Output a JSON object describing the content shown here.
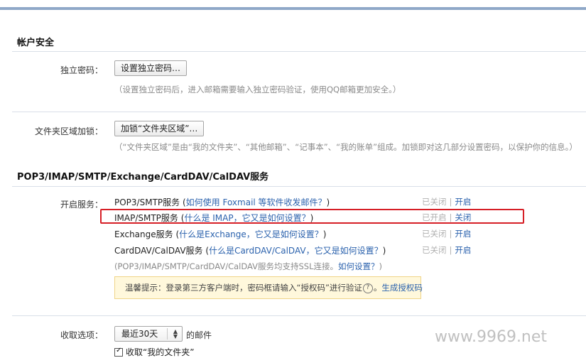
{
  "account_security": {
    "title": "帐户安全",
    "independent_password": {
      "label": "独立密码：",
      "button": "设置独立密码…",
      "hint": "（设置独立密码后，进入邮箱需要输入独立密码验证，使用QQ邮箱更加安全。）"
    },
    "folder_lock": {
      "label": "文件夹区域加锁：",
      "button": "加锁“文件夹区域”…",
      "hint": "（“文件夹区域”是由“我的文件夹”、“其他邮箱”、“记事本”、“我的账单”组成。加锁即对这几部分设置密码，以保护你的信息。）"
    }
  },
  "protocols": {
    "title": "POP3/IMAP/SMTP/Exchange/CardDAV/CalDAV服务",
    "label": "开启服务：",
    "services": [
      {
        "name": "POP3/SMTP服务",
        "help_open": "(",
        "help_link": "如何使用 Foxmail 等软件收发邮件？",
        "help_close": ")",
        "state": "已关闭",
        "separator": "|",
        "action": "开启"
      },
      {
        "name": "IMAP/SMTP服务",
        "help_open": "(",
        "help_link": "什么是 IMAP，它又是如何设置？",
        "help_close": ")",
        "state": "已开启",
        "separator": "|",
        "action": "关闭"
      },
      {
        "name": "Exchange服务",
        "help_open": "(",
        "help_link": "什么是Exchange，它又是如何设置？",
        "help_close": ")",
        "state": "已关闭",
        "separator": "|",
        "action": "开启"
      },
      {
        "name": "CardDAV/CalDAV服务",
        "help_open": "(",
        "help_link": "什么是CardDAV/CalDAV，它又是如何设置？",
        "help_close": ")",
        "state": "已关闭",
        "separator": "|",
        "action": "开启"
      }
    ],
    "ssl_note_prefix": "(POP3/IMAP/SMTP/CardDAV/CalDAV服务均支持SSL连接。",
    "ssl_note_link": "如何设置？",
    "ssl_note_suffix": ")",
    "tip_prefix": "温馨提示：登录第三方客户端时，密码框请输入“授权码”进行验证",
    "tip_qmark": "?",
    "tip_dot": "。",
    "tip_link": "生成授权码"
  },
  "receive": {
    "label": "收取选项：",
    "select_value": "最近30天",
    "after_select": "的邮件",
    "checkbox_label": "收取“我的文件夹”",
    "checkbox_mark": "✓"
  },
  "watermark": "www.9969.net",
  "colors": {
    "link": "#2b62ad",
    "highlight": "#d61f26",
    "tip_bg": "#fff8dc",
    "top_stripe": "#8fa8c8"
  }
}
